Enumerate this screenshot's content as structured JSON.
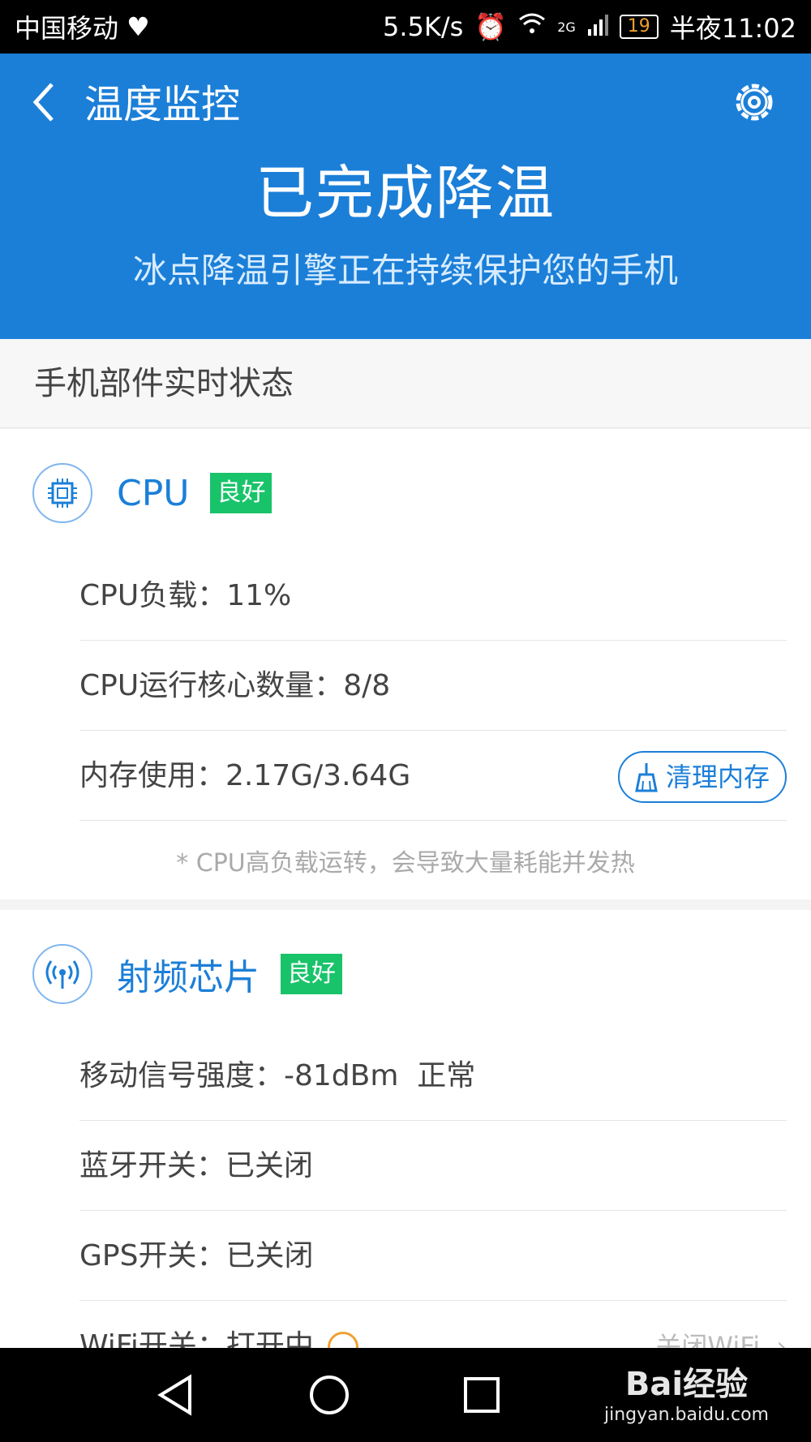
{
  "status_bar": {
    "carrier": "中国移动",
    "speed": "5.5K/s",
    "network": "2G",
    "battery": "19",
    "time": "半夜11:02"
  },
  "header": {
    "title": "温度监控",
    "headline": "已完成降温",
    "subline": "冰点降温引擎正在持续保护您的手机"
  },
  "section_title": "手机部件实时状态",
  "cpu_card": {
    "name": "CPU",
    "badge": "良好",
    "rows": [
      "CPU负载：11%",
      "CPU运行核心数量：8/8",
      "内存使用：2.17G/3.64G"
    ],
    "clean_button": "清理内存",
    "note": "* CPU高负载运转，会导致大量耗能并发热"
  },
  "rf_card": {
    "name": "射频芯片",
    "badge": "良好",
    "rows": [
      "移动信号强度：-81dBm  正常",
      "蓝牙开关：已关闭",
      "GPS开关：已关闭",
      "WiFi开关：打开中"
    ],
    "wifi_action": "关闭WiFi"
  },
  "watermark": {
    "brand": "Bai经验",
    "url": "jingyan.baidu.com"
  },
  "colors": {
    "primary": "#1b7fd8",
    "badge_green": "#19c36a"
  }
}
